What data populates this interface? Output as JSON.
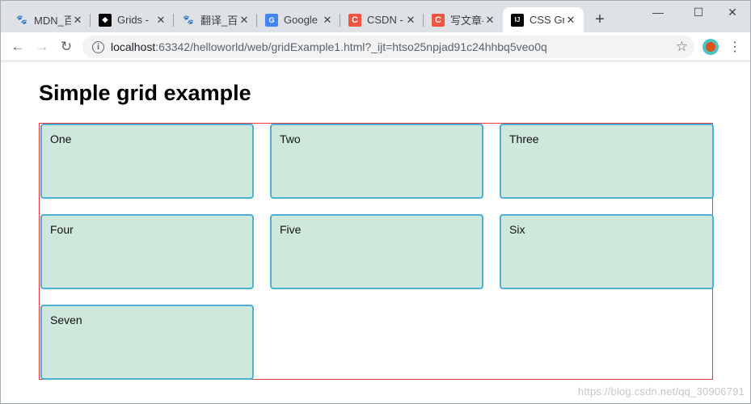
{
  "browser": {
    "tabs": [
      {
        "title": "MDN_百",
        "icon": "baidu-paw-icon"
      },
      {
        "title": "Grids - ",
        "icon": "mdn-icon"
      },
      {
        "title": "翻译_百",
        "icon": "baidu-paw-icon"
      },
      {
        "title": "Google ",
        "icon": "google-translate-icon"
      },
      {
        "title": "CSDN - ",
        "icon": "csdn-icon"
      },
      {
        "title": "写文章-",
        "icon": "csdn-icon"
      },
      {
        "title": "CSS Gri",
        "icon": "jetbrains-icon"
      }
    ],
    "active_tab_index": 6,
    "new_tab_label": "+",
    "url_host": "localhost",
    "url_rest": ":63342/helloworld/web/gridExample1.html?_ijt=htso25npjad91c24hhbq5veo0q",
    "colors": {
      "csdn": "#f1543f",
      "baidu": "#3274ff",
      "grid_border": "#e03a3a",
      "cell_bg": "#cfe8dc",
      "cell_border": "#4ab0d8"
    }
  },
  "page": {
    "heading": "Simple grid example",
    "cells": [
      "One",
      "Two",
      "Three",
      "Four",
      "Five",
      "Six",
      "Seven"
    ]
  },
  "watermark": "https://blog.csdn.net/qq_30906791"
}
